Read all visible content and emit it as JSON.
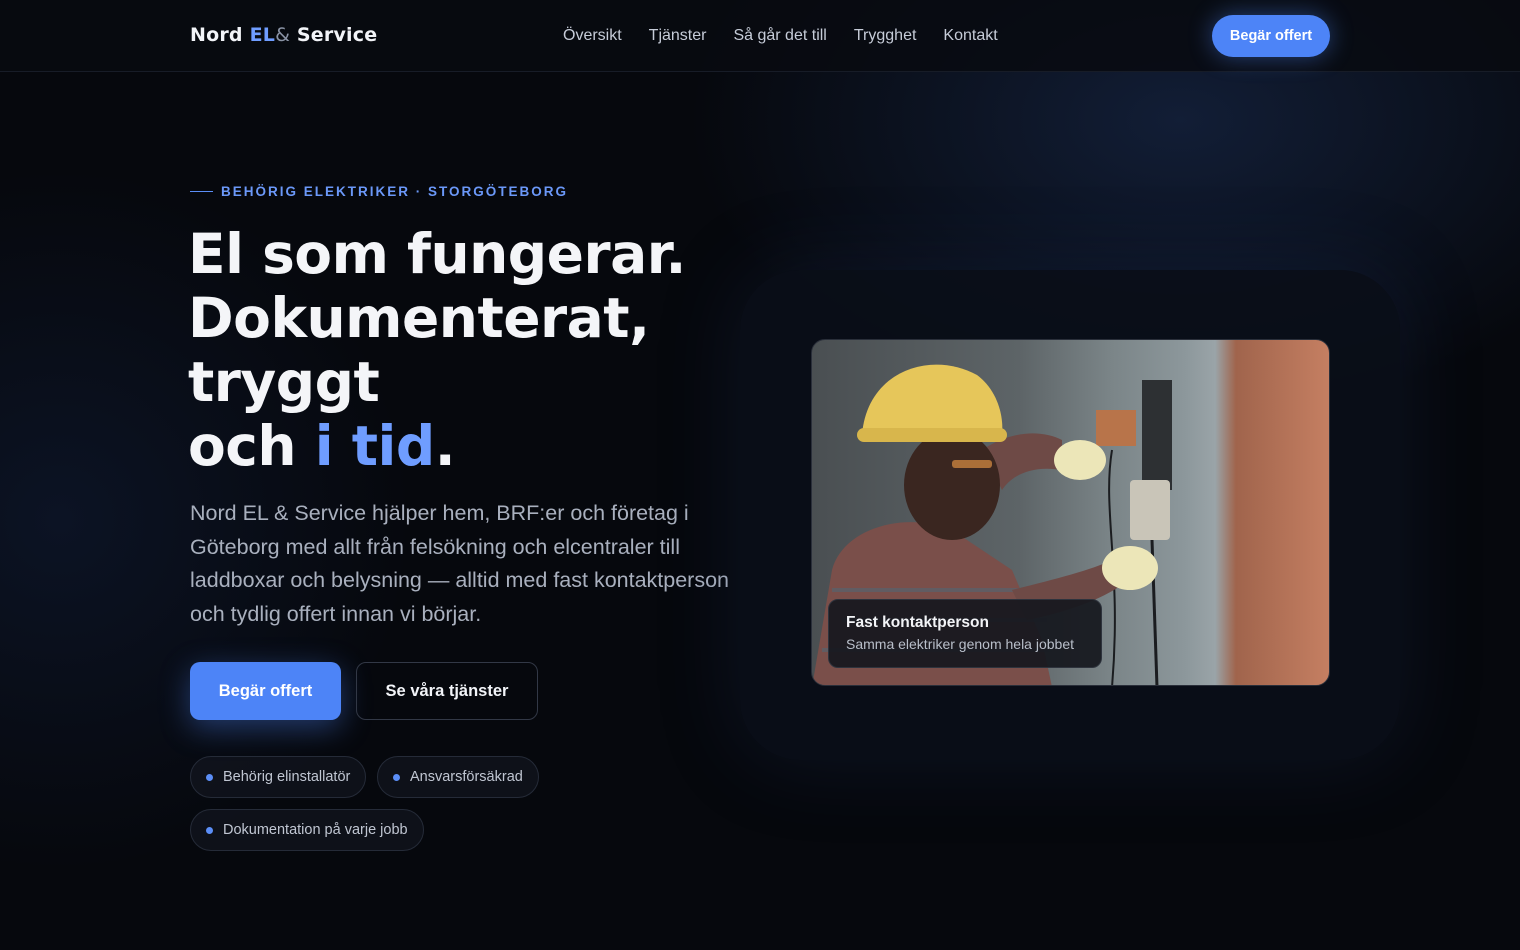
{
  "header": {
    "logo": {
      "part1": "Nord",
      "part2": "EL",
      "part3": "&",
      "part4": "Service"
    },
    "nav": [
      "Översikt",
      "Tjänster",
      "Så går det till",
      "Trygghet",
      "Kontakt"
    ],
    "cta_label": "Begär offert"
  },
  "hero": {
    "eyebrow": "BEHÖRIG ELEKTRIKER · STORGÖTEBORG",
    "headline": {
      "line1": "El som fungerar.",
      "line2": "Dokumenterat,",
      "line3": "tryggt",
      "line4_prefix": "och ",
      "line4_accent": "i tid",
      "line4_suffix": "."
    },
    "lead": "Nord EL & Service hjälper hem, BRF:er och företag i Göteborg med allt från felsökning och elcentraler till laddboxar och belysning — alltid med fast kontaktperson och tydlig offert innan vi börjar.",
    "primary_button": "Begär offert",
    "secondary_button": "Se våra tjänster",
    "badges": [
      "Behörig elinstallatör",
      "Ansvarsförsäkrad",
      "Dokumentation på varje jobb"
    ],
    "image_card": {
      "title": "Fast kontaktperson",
      "subtitle": "Samma elektriker genom hela jobbet"
    }
  },
  "colors": {
    "background": "#06080d",
    "accent": "#4d84f7",
    "accent_text": "#6f9dff"
  }
}
